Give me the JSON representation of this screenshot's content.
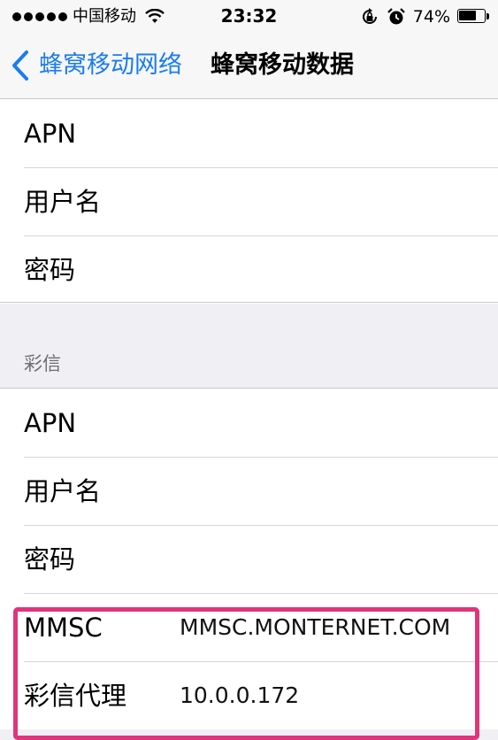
{
  "status_bar": {
    "carrier": "中国移动",
    "time": "23:32",
    "battery_percent": "74%",
    "battery_level": 0.74,
    "icons": [
      "signal-dots-icon",
      "wifi-icon",
      "rotation-lock-icon",
      "alarm-icon",
      "battery-icon"
    ]
  },
  "nav": {
    "back_label": "蜂窝移动网络",
    "title": "蜂窝移动数据"
  },
  "cellular_group": {
    "rows": [
      {
        "label": "APN"
      },
      {
        "label": "用户名"
      },
      {
        "label": "密码"
      }
    ]
  },
  "mms_section": {
    "header": "彩信",
    "rows": [
      {
        "label": "APN"
      },
      {
        "label": "用户名"
      },
      {
        "label": "密码"
      },
      {
        "label": "MMSC",
        "value": "MMSC.MONTERNET.COM"
      },
      {
        "label": "彩信代理",
        "value": "10.0.0.172"
      }
    ]
  },
  "colors": {
    "accent": "#1a7cf0",
    "highlight": "#e0357a",
    "grouped_background": "#efeff4"
  }
}
